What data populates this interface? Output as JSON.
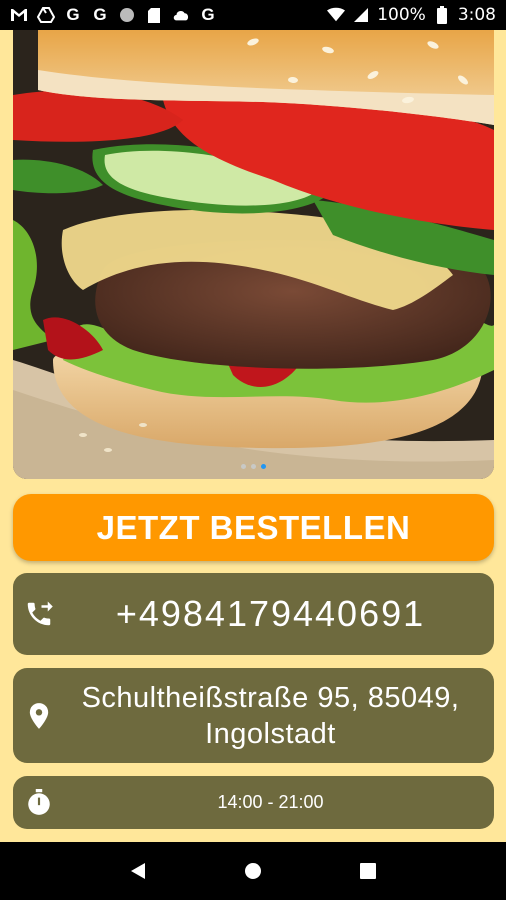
{
  "status_bar": {
    "left_icons": [
      "gmail-icon",
      "drive-icon",
      "google-icon",
      "google-icon",
      "circle-icon",
      "sd-card-icon",
      "cloud-icon",
      "google-icon"
    ],
    "battery": "100%",
    "time": "3:08"
  },
  "hero": {
    "image": "burger-photo",
    "carousel_dots": 3,
    "active_dot": 3
  },
  "order_button": {
    "label": "JETZT BESTELLEN"
  },
  "contact": {
    "phone": "+4984179440691",
    "address_line1": "Schultheißstraße 95, 85049,",
    "address_line2": "Ingolstadt",
    "hours": "14:00 - 21:00"
  },
  "colors": {
    "background": "#ffe79a",
    "accent": "#ff9800",
    "card": "#6e6a3e"
  }
}
